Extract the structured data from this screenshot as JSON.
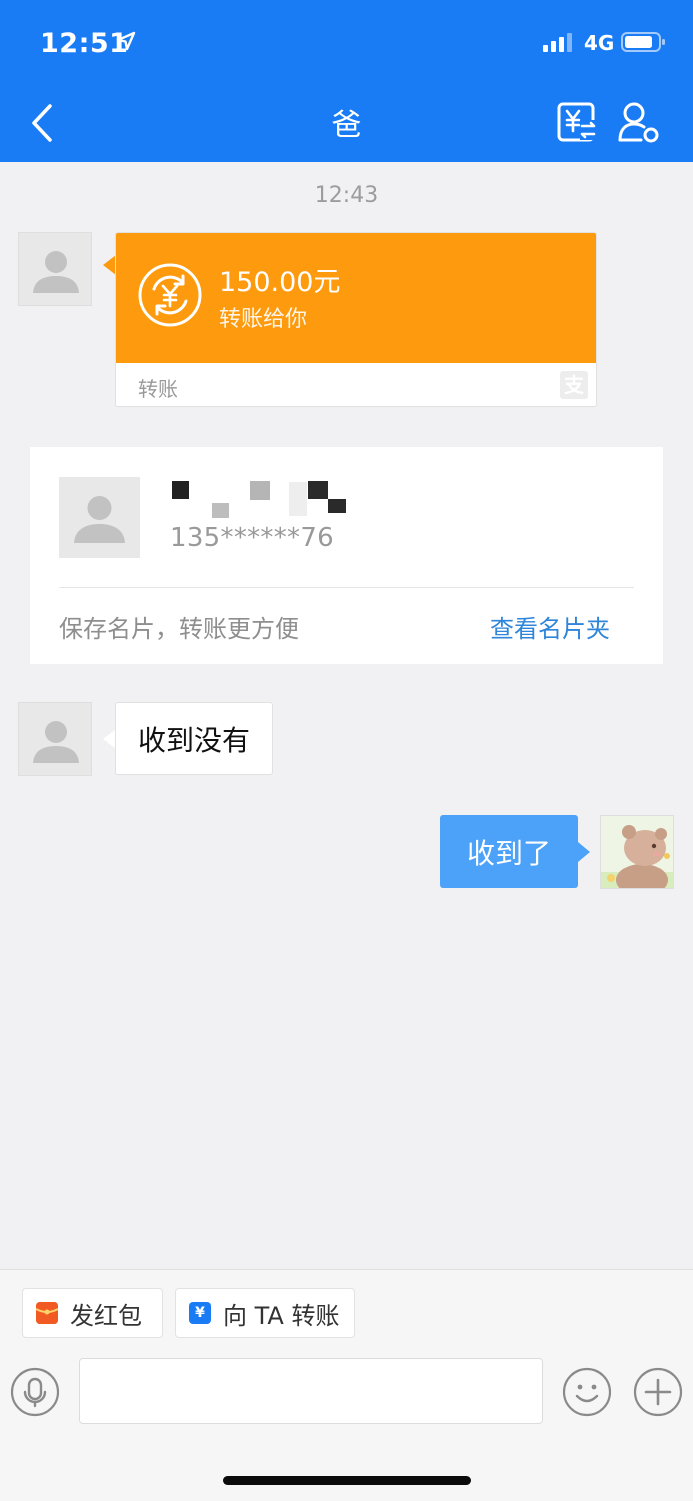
{
  "status_bar": {
    "time": "12:51",
    "network": "4G"
  },
  "header": {
    "title": "爸"
  },
  "chat": {
    "timestamp": "12:43",
    "transfer": {
      "amount": "150.00元",
      "description": "转账给你",
      "footer": "转账",
      "alipay_logo_char": "支"
    },
    "contact_card": {
      "phone": "135******76",
      "save_text": "保存名片，转账更方便",
      "view_link": "查看名片夹"
    },
    "received_message": "收到没有",
    "sent_message": "收到了"
  },
  "bottom": {
    "quick_actions": [
      {
        "label": "发红包",
        "icon": "red-packet-icon",
        "color": "#f25a24"
      },
      {
        "label": "向 TA 转账",
        "icon": "transfer-icon",
        "color": "#1a7cf5",
        "icon_char": "¥"
      }
    ],
    "input": {
      "value": "",
      "placeholder": ""
    }
  },
  "colors": {
    "header": "#1a7cf5",
    "transfer_orange": "#fe9a0e",
    "sent_bubble": "#4ca1f8",
    "link": "#2e85d9"
  }
}
